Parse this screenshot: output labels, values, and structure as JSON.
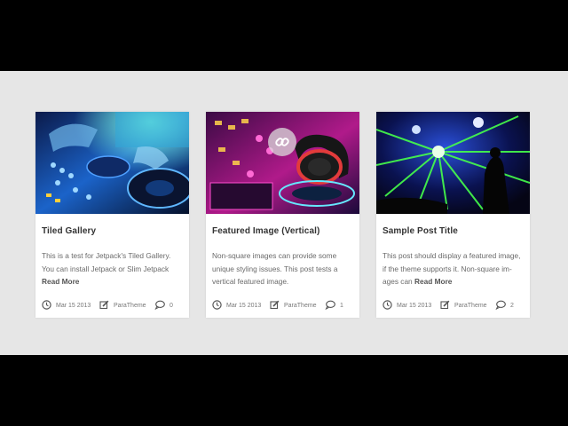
{
  "cards": [
    {
      "title": "Tiled Gallery",
      "excerpt": "This is a test for Jetpack's Tiled Gallery. You can install Jetpack or Slim Jetpack",
      "read_more": "Read More",
      "date": "Mar 15 2013",
      "author": "ParaTheme",
      "comments": "0",
      "image_icon": "dj-turntable-image"
    },
    {
      "title": "Featured Image (Vertical)",
      "excerpt": "Non-square images can provide some unique styling issues. This post tests a vertical featured image.",
      "read_more": "",
      "date": "Mar 15 2013",
      "author": "ParaTheme",
      "comments": "1",
      "image_icon": "headphones-mixer-image"
    },
    {
      "title": "Sample Post Title",
      "excerpt": "This post should display a featured image, if the theme supports it. Non-square im-ages can",
      "read_more": "Read More",
      "date": "Mar 15 2013",
      "author": "ParaTheme",
      "comments": "2",
      "image_icon": "laser-show-image"
    }
  ],
  "icons": {
    "date": "clock-icon",
    "author": "edit-icon",
    "comments": "comment-icon",
    "hover": "link-icon"
  }
}
